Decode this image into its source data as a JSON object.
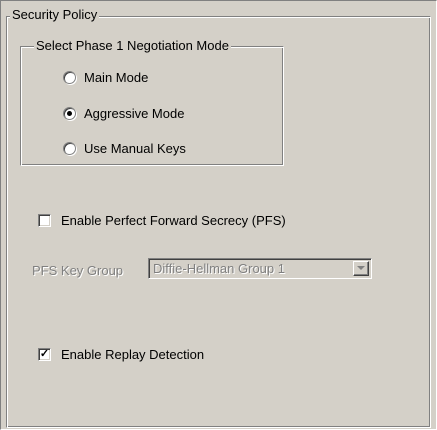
{
  "security_policy": {
    "title": "Security Policy",
    "phase1": {
      "title": "Select Phase 1 Negotiation Mode",
      "options": [
        {
          "label": "Main Mode",
          "checked": false
        },
        {
          "label": "Aggressive Mode",
          "checked": true
        },
        {
          "label": "Use Manual Keys",
          "checked": false
        }
      ]
    },
    "pfs": {
      "enable_label": "Enable Perfect Forward Secrecy (PFS)",
      "enabled": false,
      "key_group_label": "PFS Key Group",
      "key_group_value": "Diffie-Hellman Group 1"
    },
    "replay": {
      "label": "Enable Replay Detection",
      "checked": true
    }
  },
  "icons": {
    "dropdown": "chevron-down-icon"
  },
  "colors": {
    "face": "#d4d0c8",
    "shadow": "#808080",
    "highlight": "#ffffff",
    "disabled_text": "#808080"
  }
}
